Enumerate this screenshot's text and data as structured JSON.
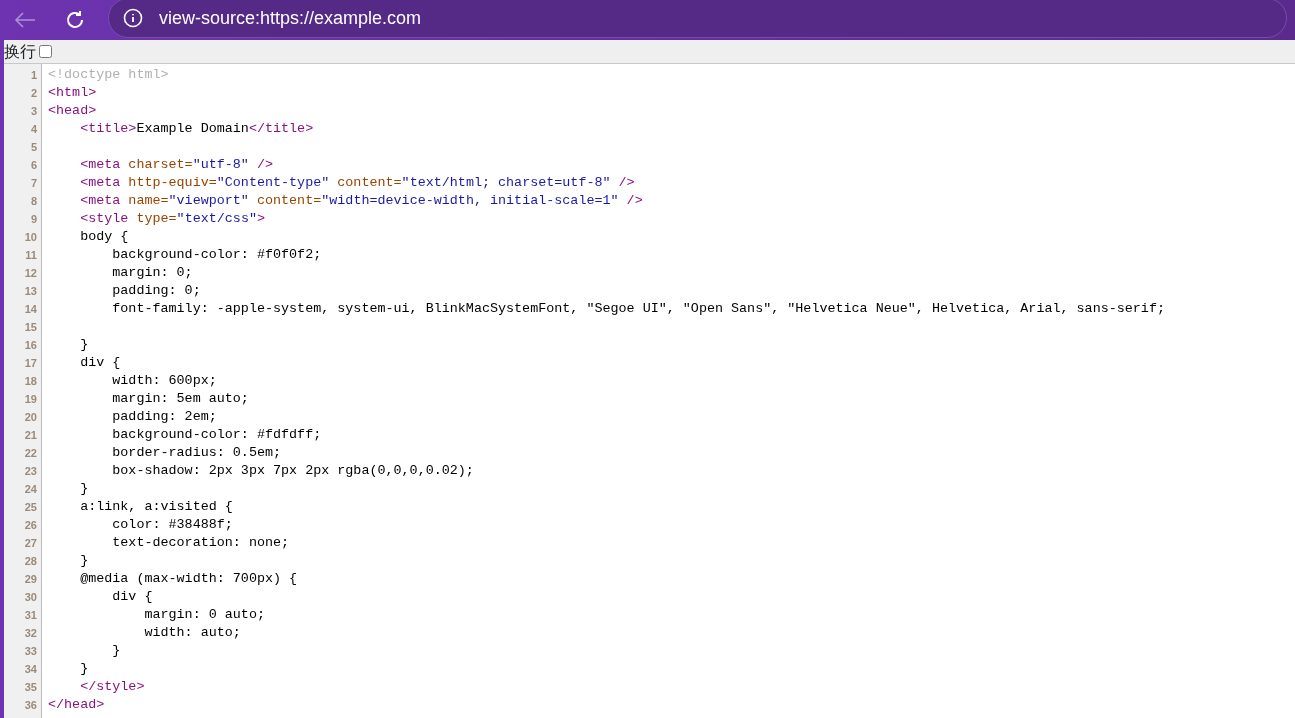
{
  "toolbar": {
    "back_disabled": true,
    "address": "view-source:https://example.com"
  },
  "wrap_option": {
    "label": "换行",
    "checked": false
  },
  "source_lines": [
    {
      "number": "1",
      "segments": [
        {
          "kind": "comment",
          "text": "<!doctype html>"
        }
      ]
    },
    {
      "number": "2",
      "segments": [
        {
          "kind": "tag",
          "text": "<html>"
        }
      ]
    },
    {
      "number": "3",
      "segments": [
        {
          "kind": "tag",
          "text": "<head>"
        }
      ]
    },
    {
      "number": "4",
      "segments": [
        {
          "kind": "tag",
          "text": "    <title>"
        },
        {
          "kind": "text",
          "text": "Example Domain"
        },
        {
          "kind": "tag",
          "text": "</title>"
        }
      ]
    },
    {
      "number": "5"
    },
    {
      "number": "6",
      "segments": [
        {
          "kind": "tag",
          "text": "    <meta "
        },
        {
          "kind": "attr",
          "text": "charset="
        },
        {
          "kind": "value",
          "text": "\"utf-8\""
        },
        {
          "kind": "tag",
          "text": " />"
        }
      ]
    },
    {
      "number": "7",
      "segments": [
        {
          "kind": "tag",
          "text": "    <meta "
        },
        {
          "kind": "attr",
          "text": "http-equiv="
        },
        {
          "kind": "value",
          "text": "\"Content-type\""
        },
        {
          "kind": "attr",
          "text": " content="
        },
        {
          "kind": "value",
          "text": "\"text/html; charset=utf-8\""
        },
        {
          "kind": "tag",
          "text": " />"
        }
      ]
    },
    {
      "number": "8",
      "segments": [
        {
          "kind": "tag",
          "text": "    <meta "
        },
        {
          "kind": "attr",
          "text": "name="
        },
        {
          "kind": "value",
          "text": "\"viewport\""
        },
        {
          "kind": "attr",
          "text": " content="
        },
        {
          "kind": "value",
          "text": "\"width=device-width, initial-scale=1\""
        },
        {
          "kind": "tag",
          "text": " />"
        }
      ]
    },
    {
      "number": "9",
      "segments": [
        {
          "kind": "tag",
          "text": "    <style "
        },
        {
          "kind": "attr",
          "text": "type="
        },
        {
          "kind": "value",
          "text": "\"text/css\""
        },
        {
          "kind": "tag",
          "text": ">"
        }
      ]
    },
    {
      "number": "10",
      "segments": [
        {
          "kind": "text",
          "text": "    body {"
        }
      ]
    },
    {
      "number": "11",
      "segments": [
        {
          "kind": "text",
          "text": "        background-color: #f0f0f2;"
        }
      ]
    },
    {
      "number": "12",
      "segments": [
        {
          "kind": "text",
          "text": "        margin: 0;"
        }
      ]
    },
    {
      "number": "13",
      "segments": [
        {
          "kind": "text",
          "text": "        padding: 0;"
        }
      ]
    },
    {
      "number": "14",
      "segments": [
        {
          "kind": "text",
          "text": "        font-family: -apple-system, system-ui, BlinkMacSystemFont, \"Segoe UI\", \"Open Sans\", \"Helvetica Neue\", Helvetica, Arial, sans-serif;"
        }
      ]
    },
    {
      "number": "15"
    },
    {
      "number": "16",
      "segments": [
        {
          "kind": "text",
          "text": "    }"
        }
      ]
    },
    {
      "number": "17",
      "segments": [
        {
          "kind": "text",
          "text": "    div {"
        }
      ]
    },
    {
      "number": "18",
      "segments": [
        {
          "kind": "text",
          "text": "        width: 600px;"
        }
      ]
    },
    {
      "number": "19",
      "segments": [
        {
          "kind": "text",
          "text": "        margin: 5em auto;"
        }
      ]
    },
    {
      "number": "20",
      "segments": [
        {
          "kind": "text",
          "text": "        padding: 2em;"
        }
      ]
    },
    {
      "number": "21",
      "segments": [
        {
          "kind": "text",
          "text": "        background-color: #fdfdff;"
        }
      ]
    },
    {
      "number": "22",
      "segments": [
        {
          "kind": "text",
          "text": "        border-radius: 0.5em;"
        }
      ]
    },
    {
      "number": "23",
      "segments": [
        {
          "kind": "text",
          "text": "        box-shadow: 2px 3px 7px 2px rgba(0,0,0,0.02);"
        }
      ]
    },
    {
      "number": "24",
      "segments": [
        {
          "kind": "text",
          "text": "    }"
        }
      ]
    },
    {
      "number": "25",
      "segments": [
        {
          "kind": "text",
          "text": "    a:link, a:visited {"
        }
      ]
    },
    {
      "number": "26",
      "segments": [
        {
          "kind": "text",
          "text": "        color: #38488f;"
        }
      ]
    },
    {
      "number": "27",
      "segments": [
        {
          "kind": "text",
          "text": "        text-decoration: none;"
        }
      ]
    },
    {
      "number": "28",
      "segments": [
        {
          "kind": "text",
          "text": "    }"
        }
      ]
    },
    {
      "number": "29",
      "segments": [
        {
          "kind": "text",
          "text": "    @media (max-width: 700px) {"
        }
      ]
    },
    {
      "number": "30",
      "segments": [
        {
          "kind": "text",
          "text": "        div {"
        }
      ]
    },
    {
      "number": "31",
      "segments": [
        {
          "kind": "text",
          "text": "            margin: 0 auto;"
        }
      ]
    },
    {
      "number": "32",
      "segments": [
        {
          "kind": "text",
          "text": "            width: auto;"
        }
      ]
    },
    {
      "number": "33",
      "segments": [
        {
          "kind": "text",
          "text": "        }"
        }
      ]
    },
    {
      "number": "34",
      "segments": [
        {
          "kind": "text",
          "text": "    }"
        }
      ]
    },
    {
      "number": "35",
      "segments": [
        {
          "kind": "tag",
          "text": "    </style>"
        }
      ]
    },
    {
      "number": "36",
      "segments": [
        {
          "kind": "tag",
          "text": "</head>"
        }
      ]
    }
  ]
}
